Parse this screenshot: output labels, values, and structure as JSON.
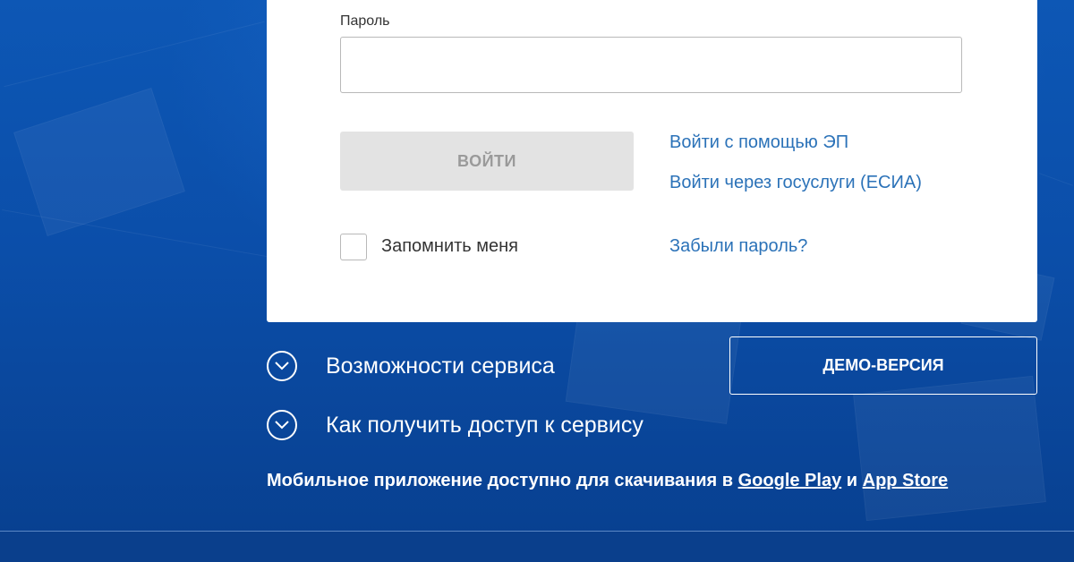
{
  "login": {
    "password_label": "Пароль",
    "password_value": "",
    "login_button": "ВОЙТИ",
    "remember_me": "Запомнить меня",
    "links": {
      "ep_login": "Войти с помощью ЭП",
      "esia_login": "Войти через госуслуги (ЕСИА)",
      "forgot_password": "Забыли пароль?"
    }
  },
  "info": {
    "features": "Возможности сервиса",
    "access": "Как получить доступ к сервису",
    "demo_button": "ДЕМО-ВЕРСИЯ"
  },
  "mobile": {
    "text_before": "Мобильное приложение доступно для скачивания в ",
    "google_play": "Google Play",
    "conjunction": " и ",
    "app_store": "App Store"
  },
  "colors": {
    "background": "#0b4ea9",
    "link": "#2b72b8",
    "button_disabled": "#e3e3e3"
  },
  "icons": {
    "accordion": "chevron-down-circle-icon"
  }
}
